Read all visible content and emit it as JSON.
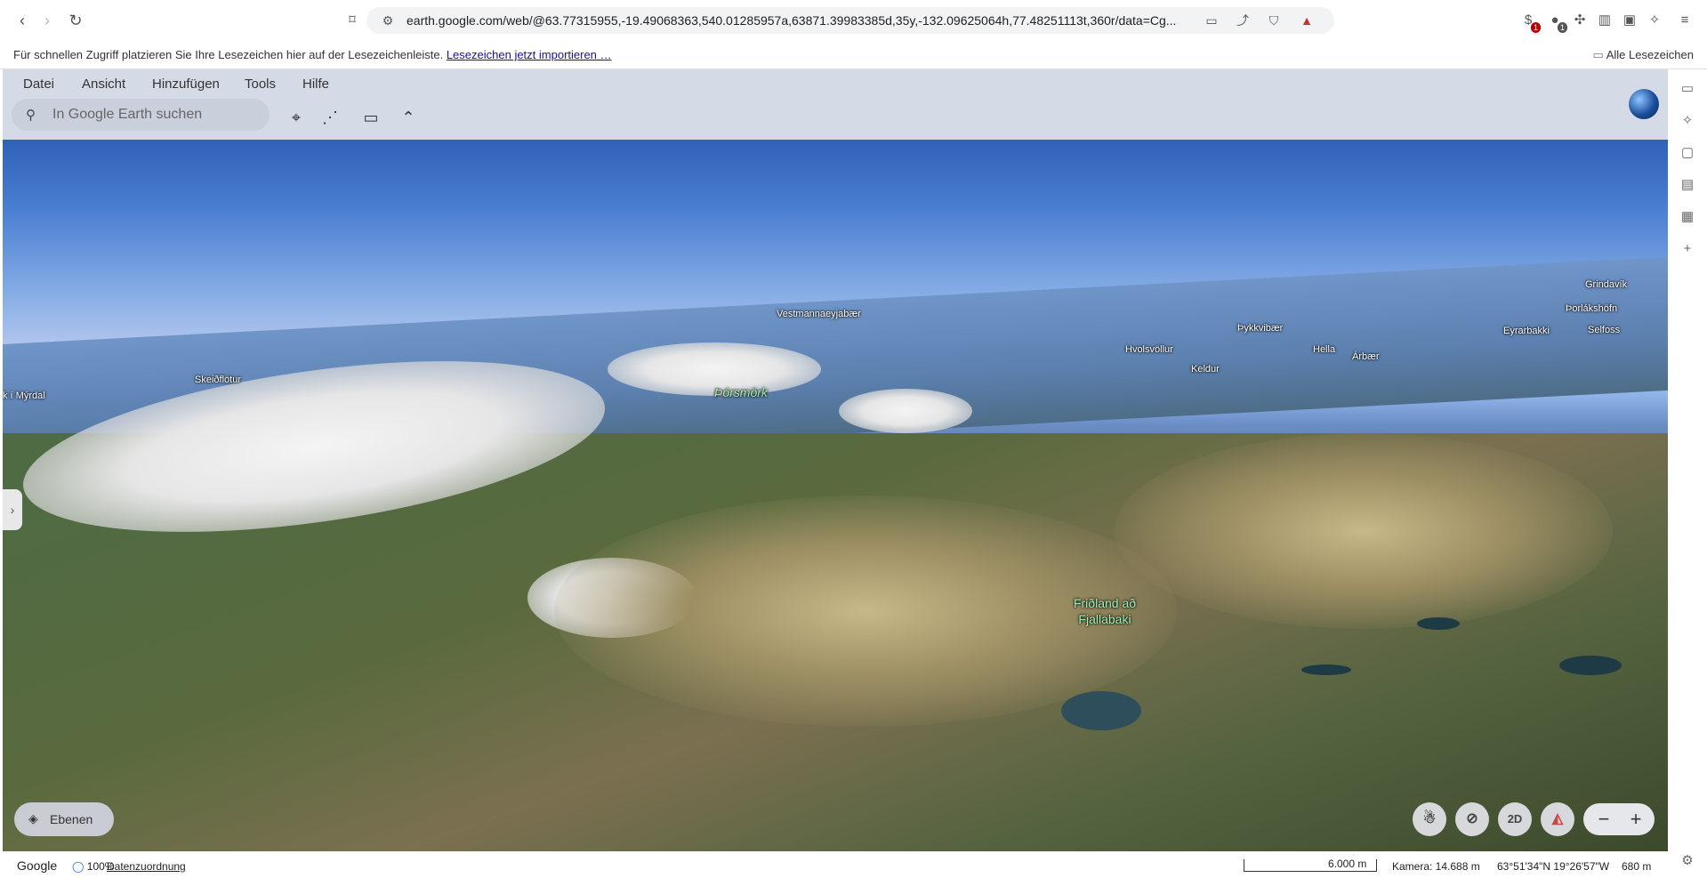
{
  "browser": {
    "url": "earth.google.com/web/@63.77315955,-19.49068363,540.01285957a,63871.39983385d,35y,-132.09625064h,77.48251113t,360r/data=Cg...",
    "extension_badges": [
      "1",
      "1"
    ]
  },
  "bookmarks_bar": {
    "hint": "Für schnellen Zugriff platzieren Sie Ihre Lesezeichen hier auf der Lesezeichenleiste.",
    "import_link": "Lesezeichen jetzt importieren …",
    "all_bookmarks": "Alle Lesezeichen"
  },
  "earth": {
    "menu": [
      "Datei",
      "Ansicht",
      "Hinzufügen",
      "Tools",
      "Hilfe"
    ],
    "search_placeholder": "In Google Earth suchen",
    "layers_label": "Ebenen",
    "mode_2d": "2D",
    "places": {
      "vestmannaeyjabaer": "Vestmannaeyjabær",
      "skeidflotur": "Skeiðflötur",
      "myrdal": "k í Mýrdal",
      "thorsmork": "Þórsmörk",
      "hvolsvollur": "Hvolsvöllur",
      "thykkvibaer": "Þykkvibær",
      "keldur": "Keldur",
      "hella": "Hella",
      "arbaer": "Árbær",
      "eyrarbakki": "Eyrarbakki",
      "selfoss": "Selfoss",
      "thorlakshofn": "Þorlákshöfn",
      "grindavik": "Grindavík",
      "fridland": "Friðland að Fjallabaki"
    }
  },
  "status": {
    "provider": "Google",
    "loading": "100%",
    "attribution": "Datenzuordnung",
    "scale": "6.000 m",
    "camera": "Kamera: 14.688 m",
    "coords": "63°51'34\"N 19°26'57\"W",
    "elevation": "680 m"
  }
}
